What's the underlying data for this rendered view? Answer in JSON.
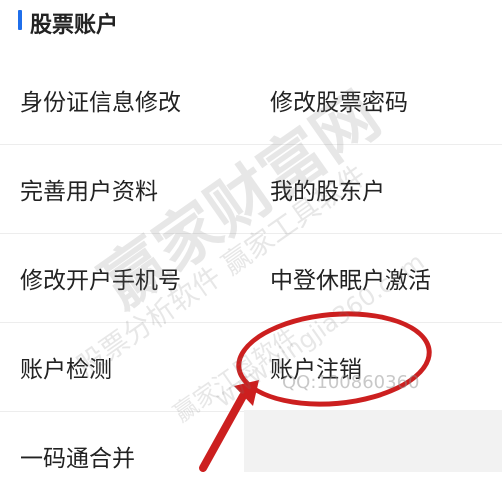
{
  "section": {
    "title": "股票账户"
  },
  "grid": {
    "rows": [
      {
        "left": "身份证信息修改",
        "right": "修改股票密码"
      },
      {
        "left": "完善用户资料",
        "right": "我的股东户"
      },
      {
        "left": "修改开户手机号",
        "right": "中登休眠户激活"
      },
      {
        "left": "账户检测",
        "right": "账户注销"
      },
      {
        "left": "一码通合并"
      }
    ]
  },
  "watermarks": {
    "brand_main": "赢家财富网",
    "brand_sub": "股票分析软件 赢家工具软件",
    "site": "www.yingjia360.com",
    "brand_small": "赢家江恩软件",
    "qq": "QQ:100860360"
  },
  "colors": {
    "accent": "#1f6feb",
    "annotation": "#cc1f1f",
    "text": "#222222",
    "background": "#ffffff"
  },
  "annotation": {
    "highlight_target": "账户注销",
    "type": "ellipse-with-arrow"
  }
}
